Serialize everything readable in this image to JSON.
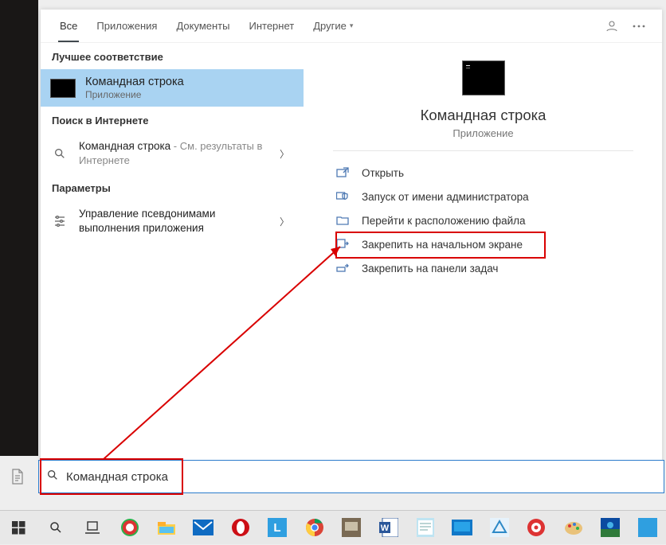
{
  "tabs": {
    "items": [
      {
        "label": "Все",
        "active": true
      },
      {
        "label": "Приложения"
      },
      {
        "label": "Документы"
      },
      {
        "label": "Интернет"
      },
      {
        "label": "Другие",
        "dropdown": true
      }
    ]
  },
  "sections": {
    "best_match": "Лучшее соответствие",
    "web": "Поиск в Интернете",
    "settings": "Параметры"
  },
  "best": {
    "title": "Командная строка",
    "sub": "Приложение"
  },
  "web_result": {
    "title": "Командная строка",
    "sub_prefix": " - ",
    "sub": "См. результаты в Интернете"
  },
  "settings_result": {
    "title": "Управление псевдонимами выполнения приложения"
  },
  "detail": {
    "title": "Командная строка",
    "sub": "Приложение",
    "actions": [
      {
        "icon": "open",
        "label": "Открыть"
      },
      {
        "icon": "admin",
        "label": "Запуск от имени администратора"
      },
      {
        "icon": "location",
        "label": "Перейти к расположению файла"
      },
      {
        "icon": "pin-start",
        "label": "Закрепить на начальном экране"
      },
      {
        "icon": "pin-task",
        "label": "Закрепить на панели задач"
      }
    ]
  },
  "search": {
    "value": "Командная строка"
  },
  "taskbar": {
    "items": [
      "start",
      "search",
      "taskview",
      "opera1",
      "explorer",
      "mail",
      "opera2",
      "app-l",
      "chrome",
      "device",
      "word",
      "notepad",
      "screen1",
      "recycle",
      "movavi",
      "paint",
      "photos",
      "other"
    ]
  }
}
